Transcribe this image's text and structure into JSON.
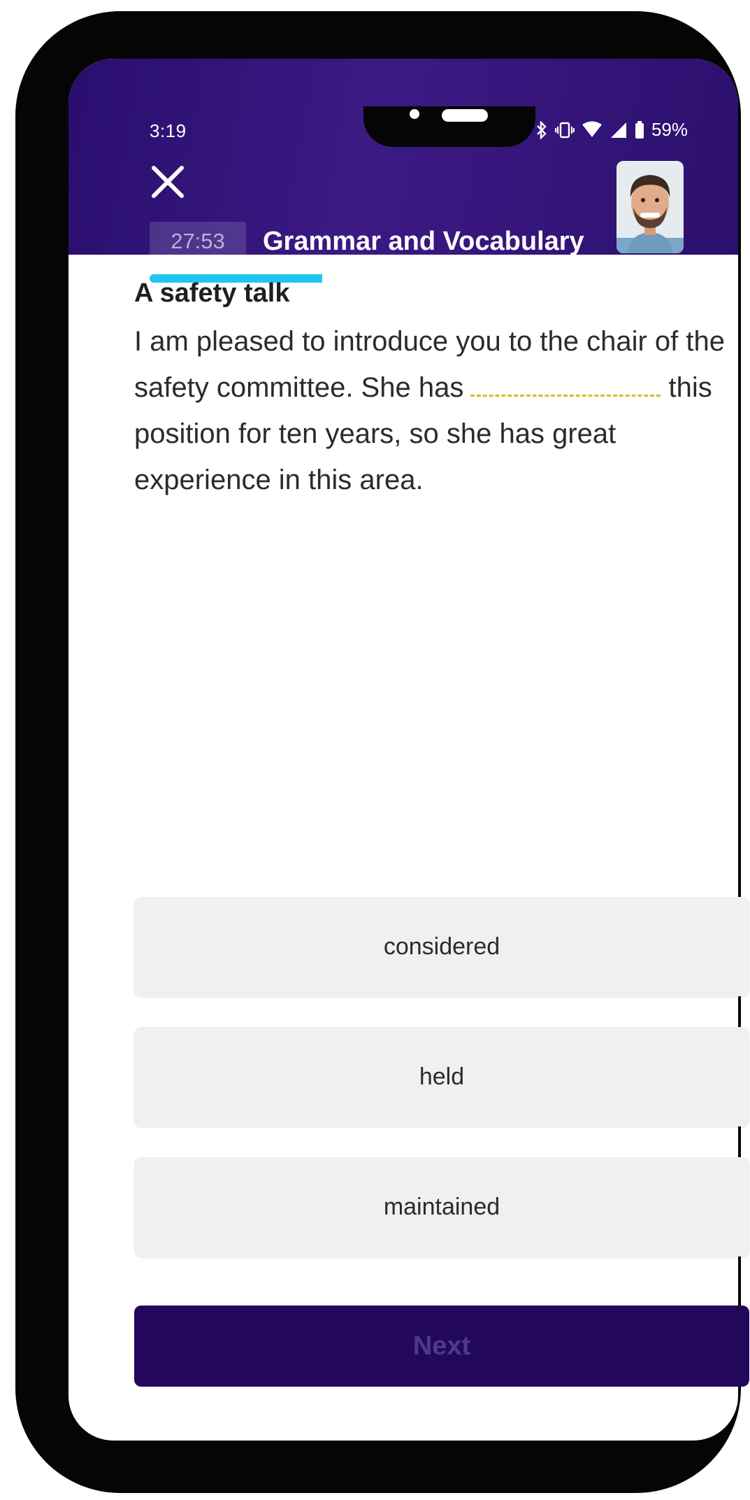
{
  "status_bar": {
    "time": "3:19",
    "battery": "59%",
    "icons": [
      "bluetooth-icon",
      "vibrate-icon",
      "wifi-icon",
      "signal-icon",
      "battery-icon"
    ]
  },
  "header": {
    "timer": "27:53",
    "title": "Grammar and Vocabulary",
    "progress_fraction_first_segment": 0.85
  },
  "question": {
    "title": "A safety talk",
    "text_before_blank": "I am pleased to introduce you to the chair of the safety committee. She has",
    "text_after_blank": "this position for ten years, so she has great experience in this area."
  },
  "options": [
    {
      "label": "considered"
    },
    {
      "label": "held"
    },
    {
      "label": "maintained"
    }
  ],
  "actions": {
    "next_label": "Next"
  },
  "colors": {
    "header_bg": "#2e1174",
    "progress_fill": "#1fc7f0",
    "blank_dash": "#e0b726",
    "next_bg": "#22075c"
  }
}
